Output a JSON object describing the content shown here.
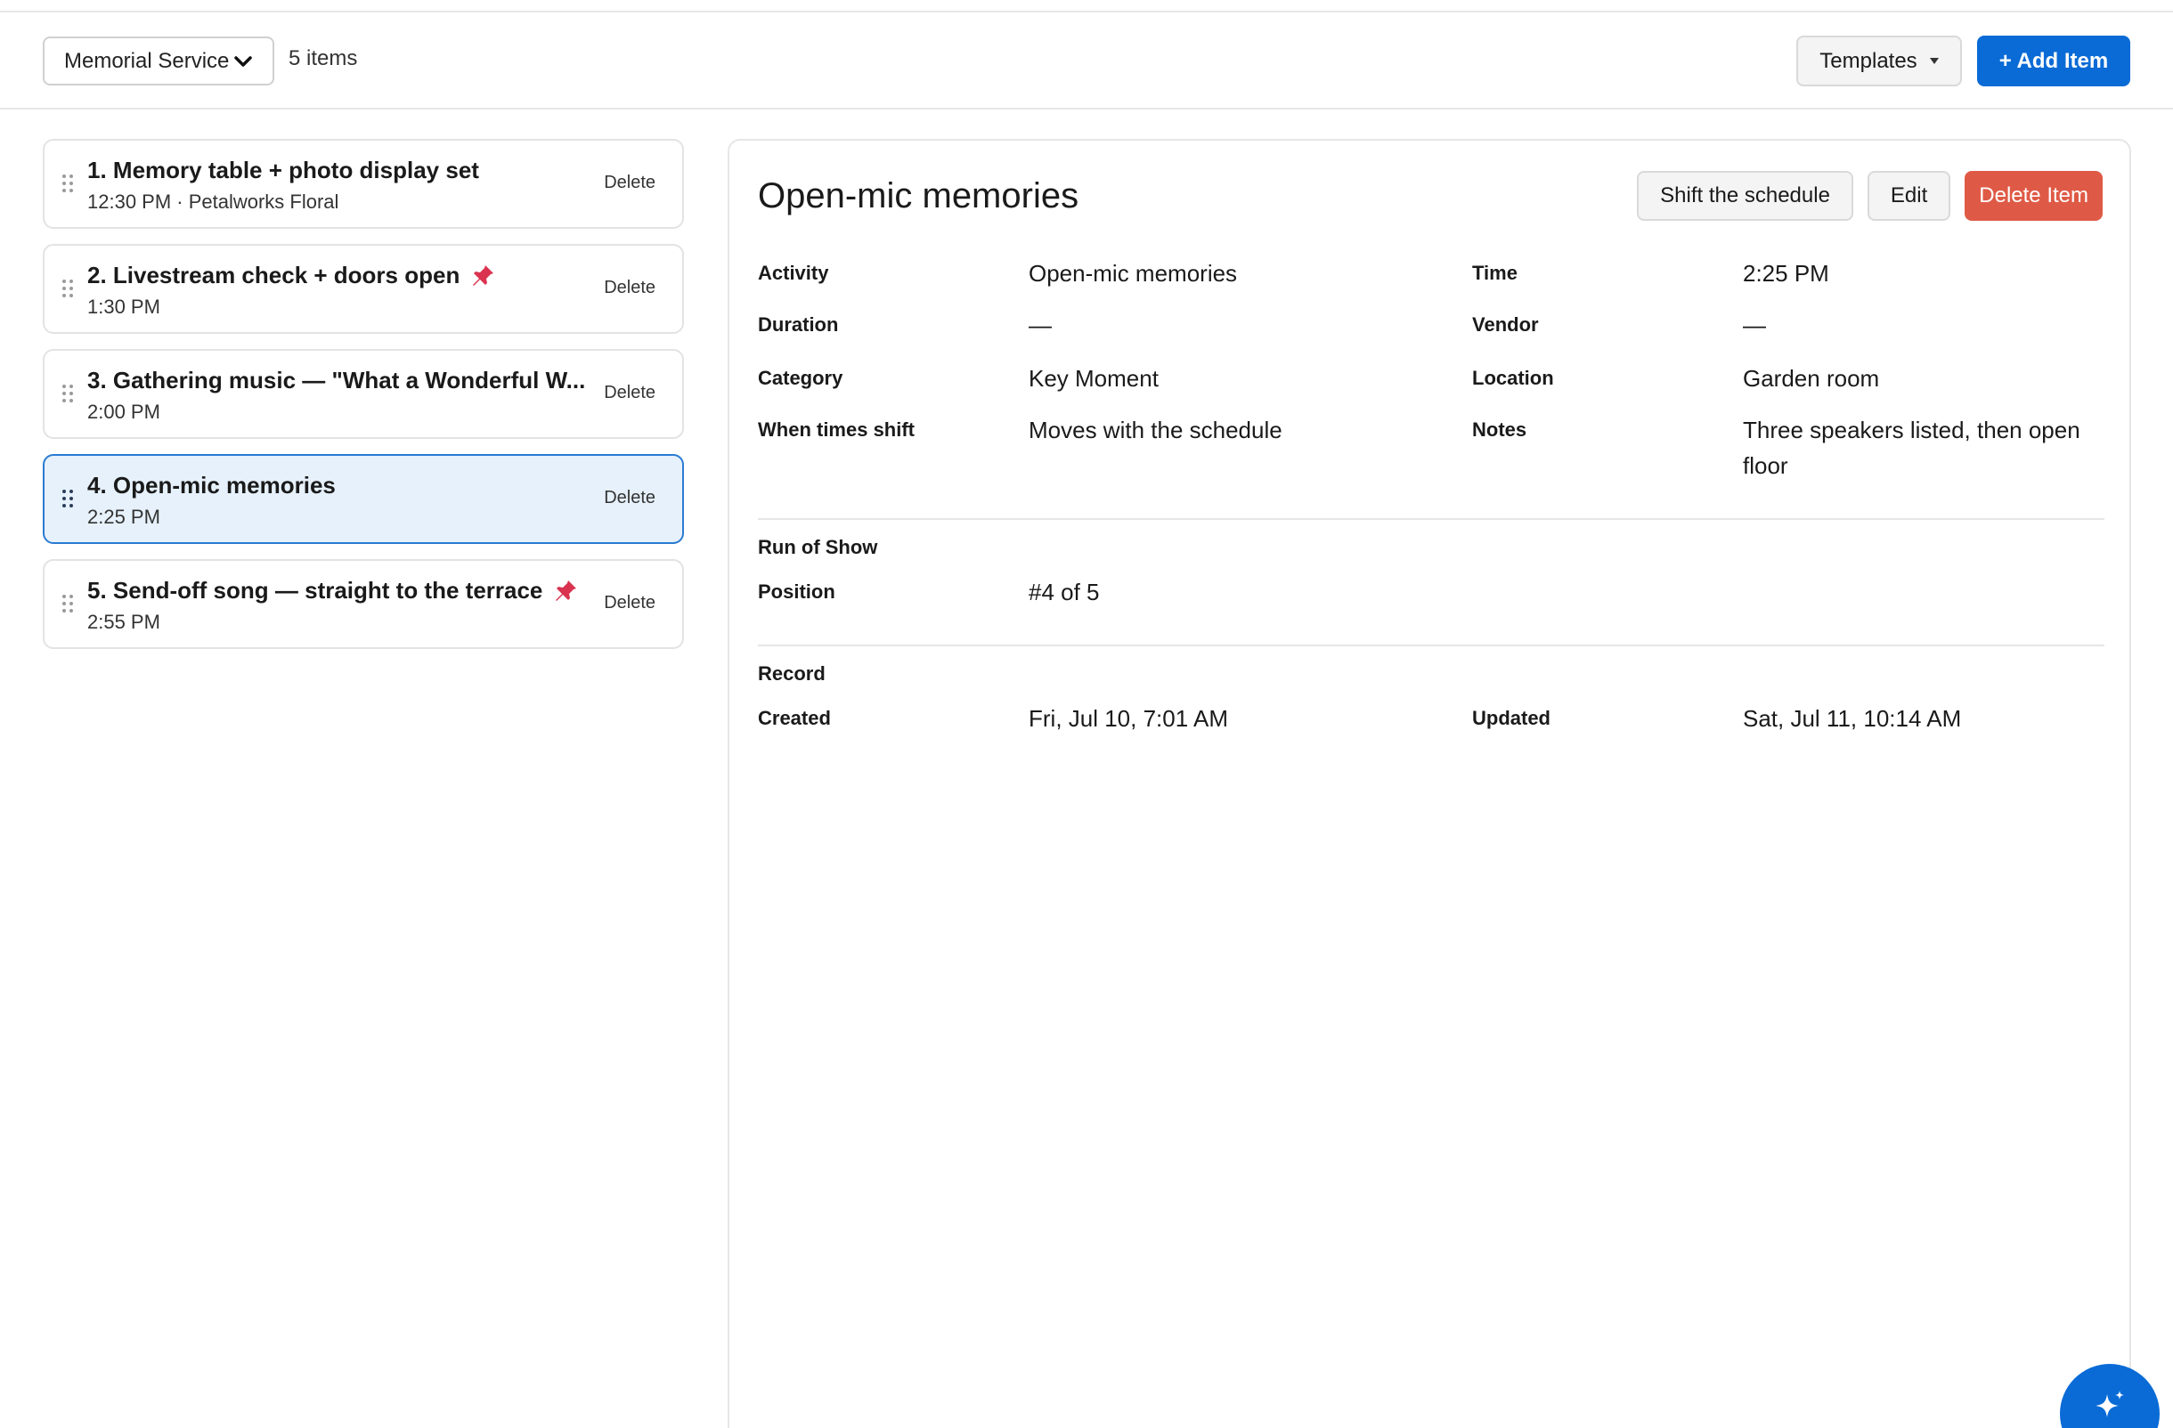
{
  "toolbar": {
    "schedule_name": "Memorial Service",
    "item_count": "5 items",
    "templates_label": "Templates",
    "add_item_label": "+ Add Item"
  },
  "items": [
    {
      "title": "1. Memory table + photo display set",
      "sub": "12:30 PM · Petalworks Floral",
      "pinned": false,
      "delete": "Delete"
    },
    {
      "title": "2. Livestream check + doors open",
      "sub": "1:30 PM",
      "pinned": true,
      "delete": "Delete"
    },
    {
      "title": "3. Gathering music — \"What a Wonderful W...",
      "sub": "2:00 PM",
      "pinned": false,
      "delete": "Delete"
    },
    {
      "title": "4. Open-mic memories",
      "sub": "2:25 PM",
      "pinned": false,
      "delete": "Delete",
      "selected": true
    },
    {
      "title": "5. Send-off song — straight to the terrace",
      "sub": "2:55 PM",
      "pinned": true,
      "delete": "Delete"
    }
  ],
  "detail": {
    "title": "Open-mic memories",
    "shift_label": "Shift the schedule",
    "edit_label": "Edit",
    "delete_label": "Delete Item",
    "fields": {
      "activity_label": "Activity",
      "activity": "Open-mic memories",
      "time_label": "Time",
      "time": "2:25 PM",
      "duration_label": "Duration",
      "duration": "—",
      "vendor_label": "Vendor",
      "vendor": "—",
      "category_label": "Category",
      "category": "Key Moment",
      "location_label": "Location",
      "location": "Garden room",
      "shift_label": "When times shift",
      "shift": "Moves with the schedule",
      "notes_label": "Notes",
      "notes": "Three speakers listed, then open floor"
    },
    "run_of_show": {
      "section": "Run of Show",
      "position_label": "Position",
      "position": "#4 of 5"
    },
    "record": {
      "section": "Record",
      "created_label": "Created",
      "created": "Fri, Jul 10, 7:01 AM",
      "updated_label": "Updated",
      "updated": "Sat, Jul 11, 10:14 AM"
    }
  },
  "icons": {
    "pin": "pushpin-icon",
    "drag": "drag-handle-icon",
    "fab": "sparkle-icon"
  },
  "colors": {
    "primary": "#0a6bd6",
    "danger": "#df5a46",
    "selected_bg": "#e6f1fb",
    "pin": "#d9334f"
  }
}
